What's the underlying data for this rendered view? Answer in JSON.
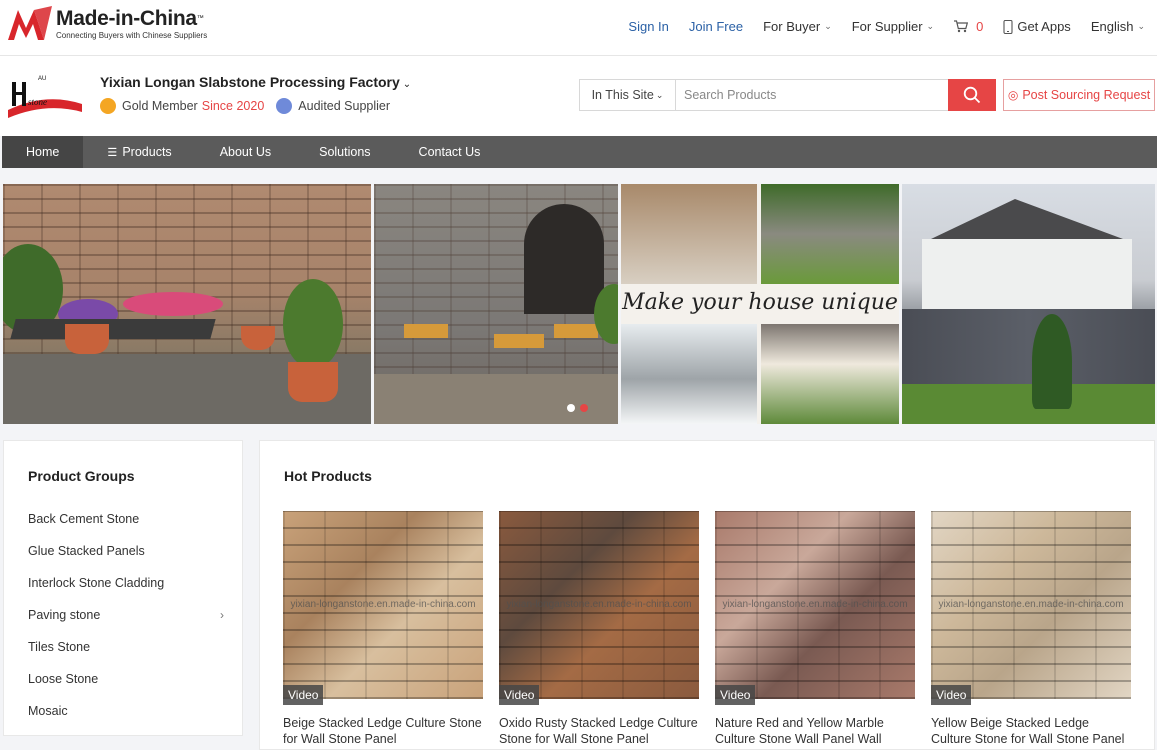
{
  "site": {
    "brand": "Made-in-China",
    "brand_tm": "™",
    "tagline": "Connecting Buyers with Chinese Suppliers",
    "topnav": {
      "sign_in": "Sign In",
      "join_free": "Join Free",
      "for_buyer": "For Buyer",
      "for_supplier": "For Supplier",
      "cart_count": "0",
      "get_apps": "Get Apps",
      "language": "English"
    }
  },
  "shop": {
    "logo_text": "Hstone",
    "name": "Yixian Longan Slabstone Processing Factory",
    "gold_label": "Gold Member",
    "since": "Since 2020",
    "audited": "Audited Supplier",
    "search": {
      "scope": "In This Site",
      "placeholder": "Search Products"
    },
    "post_request": "Post Sourcing Request"
  },
  "nav": {
    "items": [
      "Home",
      "Products",
      "About Us",
      "Solutions",
      "Contact Us"
    ]
  },
  "banner": {
    "slogan": "Make your house unique",
    "slides": 2,
    "active_slide": 2
  },
  "groups": {
    "title": "Product Groups",
    "items": [
      {
        "label": "Back Cement Stone"
      },
      {
        "label": "Glue Stacked Panels"
      },
      {
        "label": "Interlock Stone Cladding"
      },
      {
        "label": "Paving stone",
        "arrow": "›"
      },
      {
        "label": "Tiles Stone"
      },
      {
        "label": "Loose Stone"
      },
      {
        "label": "Mosaic"
      }
    ]
  },
  "hot": {
    "title": "Hot Products",
    "video_label": "Video",
    "products": [
      {
        "title": "Beige Stacked Ledge Culture Stone for Wall Stone Panel",
        "watermark": "yixian-longanstone.en.made-in-china.com",
        "colors": [
          "#c9a27a",
          "#a9825e",
          "#d8bf9e"
        ]
      },
      {
        "title": "Oxido Rusty Stacked Ledge Culture Stone for Wall Stone Panel",
        "watermark": "yixian-longanstone.en.made-in-china.com",
        "colors": [
          "#8a5a3e",
          "#5e4a3e",
          "#a46b45"
        ]
      },
      {
        "title": "Nature Red and Yellow Marble Culture Stone Wall Panel Wall Decoration...",
        "watermark": "yixian-longanstone.en.made-in-china.com",
        "colors": [
          "#a97a6b",
          "#c9a89a",
          "#7a5a52"
        ]
      },
      {
        "title": "Yellow Beige Stacked Ledge Culture Stone for Wall Stone Panel",
        "watermark": "yixian-longanstone.en.made-in-china.com",
        "colors": [
          "#e2d6c4",
          "#cdb89a",
          "#b9a58a"
        ]
      }
    ]
  },
  "colors": {
    "accent": "#e64545",
    "link": "#2b61a6",
    "navbar": "#5b5b5b"
  }
}
